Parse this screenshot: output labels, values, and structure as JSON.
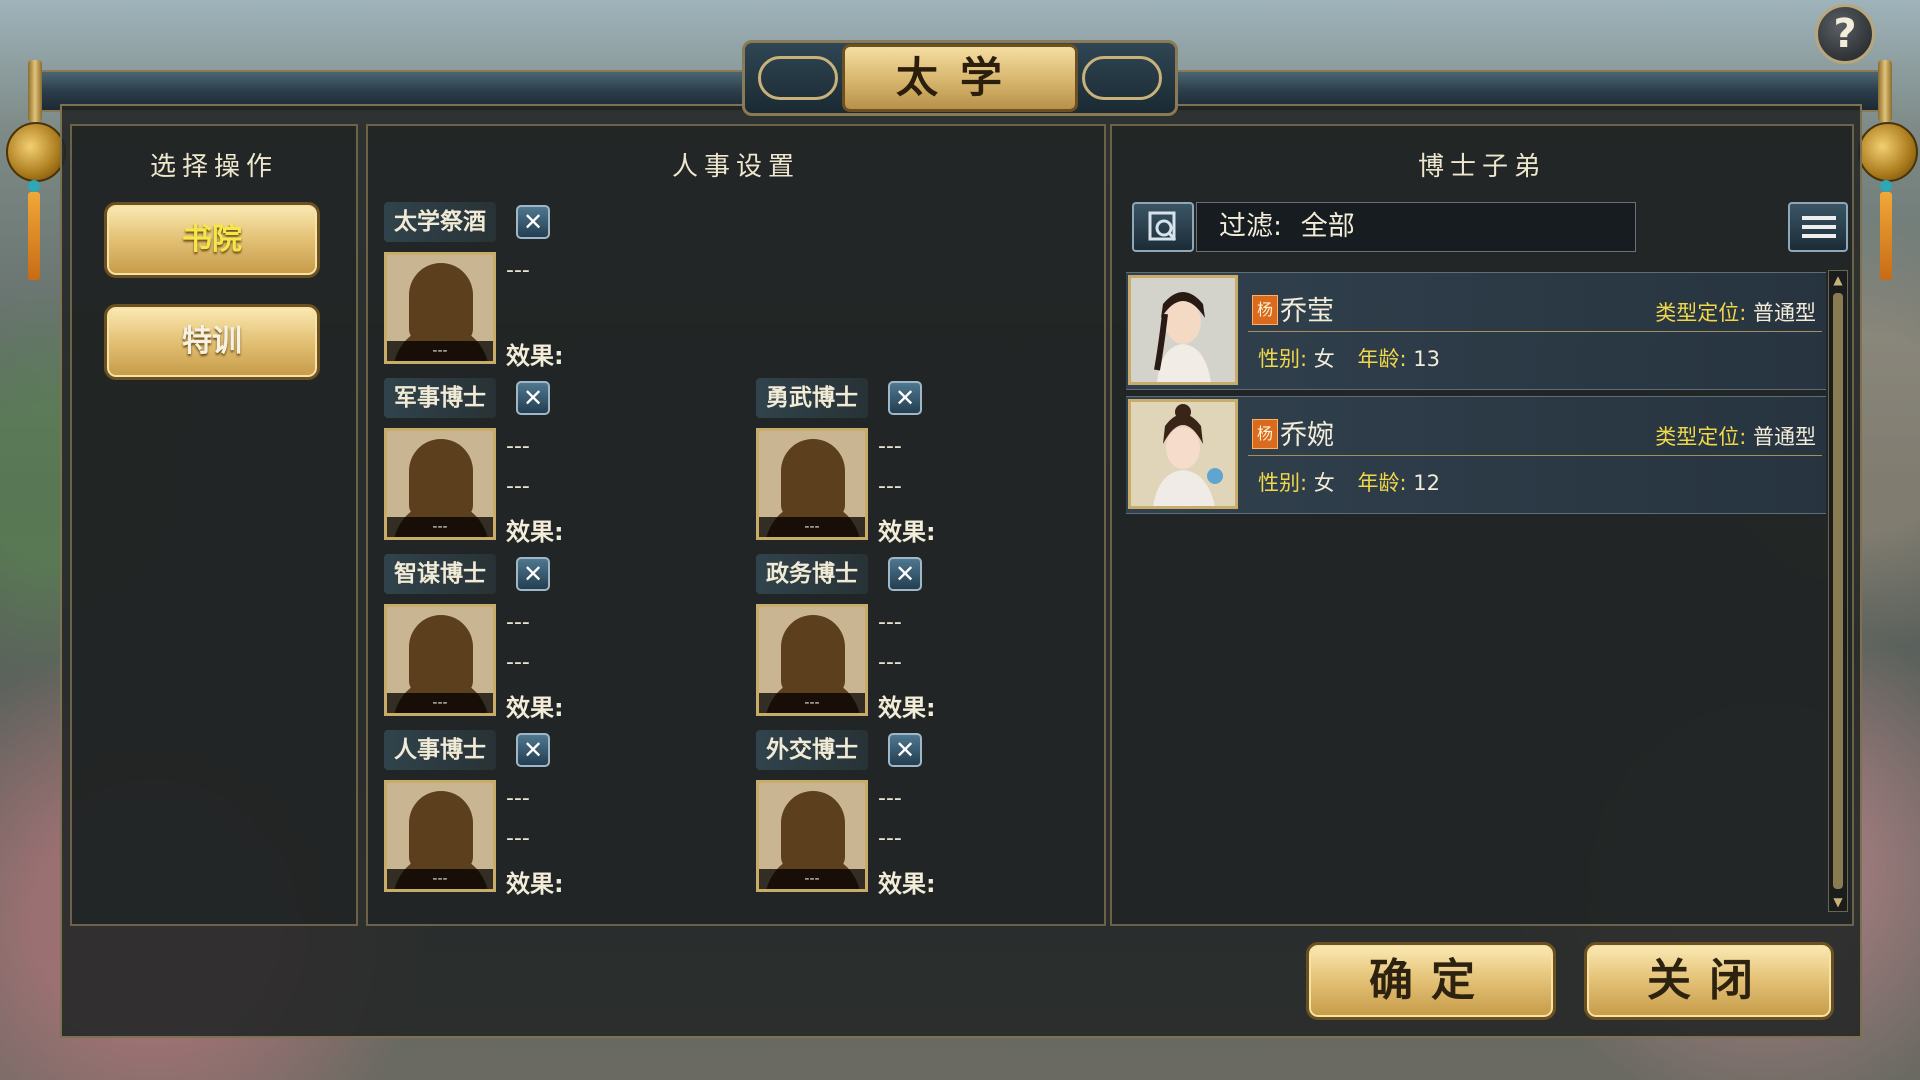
{
  "window": {
    "title": "太学",
    "help_label": "?"
  },
  "left_panel": {
    "title": "选择操作",
    "buttons": [
      {
        "label": "书院",
        "state": "active"
      },
      {
        "label": "特训",
        "state": "normal"
      }
    ]
  },
  "middle_panel": {
    "title": "人事设置",
    "clear_icon": "x-icon",
    "effect_label": "效果:",
    "placeholder": "---",
    "slots": [
      {
        "label": "太学祭酒",
        "portrait_name": "---",
        "line1": "---",
        "line2": ""
      },
      {
        "label": "军事博士",
        "portrait_name": "---",
        "line1": "---",
        "line2": "---"
      },
      {
        "label": "勇武博士",
        "portrait_name": "---",
        "line1": "---",
        "line2": "---"
      },
      {
        "label": "智谋博士",
        "portrait_name": "---",
        "line1": "---",
        "line2": "---"
      },
      {
        "label": "政务博士",
        "portrait_name": "---",
        "line1": "---",
        "line2": "---"
      },
      {
        "label": "人事博士",
        "portrait_name": "---",
        "line1": "---",
        "line2": "---"
      },
      {
        "label": "外交博士",
        "portrait_name": "---",
        "line1": "---",
        "line2": "---"
      }
    ]
  },
  "right_panel": {
    "title": "博士子弟",
    "filter": {
      "label": "过滤:",
      "value": "全部"
    },
    "students": [
      {
        "surname_badge": "杨",
        "name": "乔莹",
        "type_label": "类型定位:",
        "type_value": "普通型",
        "gender_label": "性别:",
        "gender_value": "女",
        "age_label": "年龄:",
        "age_value": "13"
      },
      {
        "surname_badge": "杨",
        "name": "乔婉",
        "type_label": "类型定位:",
        "type_value": "普通型",
        "gender_label": "性别:",
        "gender_value": "女",
        "age_label": "年龄:",
        "age_value": "12"
      }
    ]
  },
  "footer": {
    "confirm_label": "确定",
    "close_label": "关闭"
  },
  "colors": {
    "gold": "#e6c47a",
    "highlight_yellow": "#f0d84a",
    "panel_border": "#6c6247"
  }
}
